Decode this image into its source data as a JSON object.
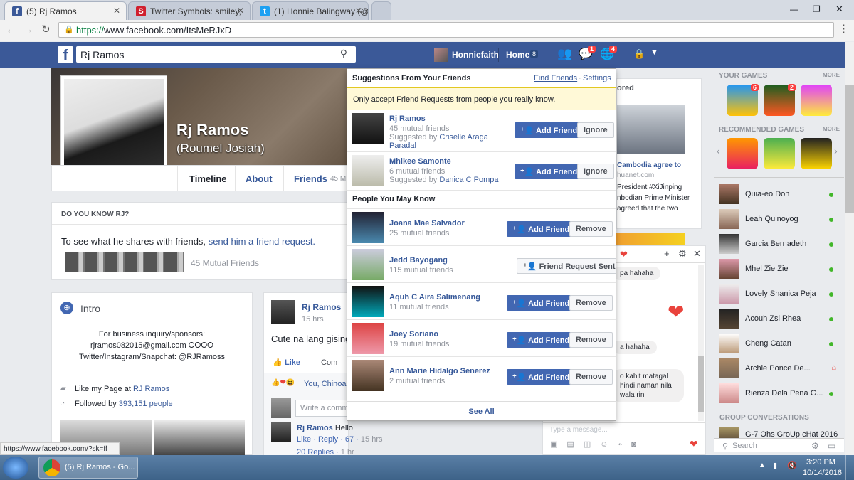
{
  "browser": {
    "tabs": [
      {
        "title": "(5) Rj Ramos",
        "favicon": "f"
      },
      {
        "title": "Twitter Symbols: smiley,",
        "favicon": "S"
      },
      {
        "title": "(1) Honnie Balingway (@",
        "favicon": "t"
      }
    ],
    "url_scheme": "https://",
    "url_rest": "www.facebook.com/ItsMeRJxD",
    "status_url": "https://www.facebook.com/?sk=ff"
  },
  "fb": {
    "search_value": "Rj Ramos",
    "user_name": "Honniefaith",
    "home_label": "Home",
    "home_count": "8",
    "msg_badge": "1",
    "notif_badge": "4"
  },
  "profile": {
    "name": "Rj Ramos",
    "alt_name": "(Roumel Josiah)",
    "tabs": [
      "Timeline",
      "About",
      "Friends",
      "45 M"
    ],
    "know_header": "DO YOU KNOW RJ?",
    "know_text": "To see what he shares with friends,",
    "know_link": "send him a friend request.",
    "mutual": "45 Mutual Friends",
    "intro_title": "Intro",
    "intro_lines": [
      "For business inquiry/sponsors:",
      "rjramos082015@gmail.com ⭘⭘⭘⭘",
      "Twitter/Instagram/Snapchat: @RJRamoss"
    ],
    "likes_page": "Like my Page at",
    "likes_page_link": "RJ Ramos",
    "followed_by": "Followed by",
    "followers": "393,151 people"
  },
  "post": {
    "author": "Rj Ramos",
    "time": "15 hrs",
    "text": "Cute na lang gising",
    "like": "Like",
    "comment": "Com",
    "reactions": "You, Chinoa",
    "comment_placeholder": "Write a comme",
    "reply_author": "Rj Ramos",
    "reply_text": "Hello",
    "reply_like": "Like",
    "reply_reply": "Reply",
    "reply_count": "67",
    "reply_time": "15 hrs",
    "replies": "20 Replies",
    "replies_time": "1 hr"
  },
  "dropdown": {
    "title": "Suggestions From Your Friends",
    "find_friends": "Find Friends",
    "settings": "Settings",
    "notice": "Only accept Friend Requests from people you really know.",
    "suggested": [
      {
        "name": "Rj Ramos",
        "mutual": "45 mutual friends",
        "by_label": "Suggested by",
        "by": "Criselle Araga Paradal",
        "add": "Add Friend",
        "ignore": "Ignore"
      },
      {
        "name": "Mhikee Samonte",
        "mutual": "6 mutual friends",
        "by_label": "Suggested by",
        "by": "Danica C Pompa",
        "add": "Add Friend",
        "ignore": "Ignore"
      }
    ],
    "pymk_title": "People You May Know",
    "people": [
      {
        "name": "Joana Mae Salvador",
        "mutual": "25 mutual friends",
        "action": "Add Friend",
        "remove": "Remove"
      },
      {
        "name": "Jedd Bayogang",
        "mutual": "115 mutual friends",
        "action": "Friend Request Sent",
        "remove": ""
      },
      {
        "name": "Aquh C Aira Salimenang",
        "mutual": "11 mutual friends",
        "action": "Add Friend",
        "remove": "Remove"
      },
      {
        "name": "Joey Soriano",
        "mutual": "19 mutual friends",
        "action": "Add Friend",
        "remove": "Remove"
      },
      {
        "name": "Ann Marie Hidalgo Senerez",
        "mutual": "2 mutual friends",
        "action": "Add Friend",
        "remove": "Remove"
      }
    ],
    "see_all": "See All"
  },
  "sponsored": {
    "label": "ored",
    "headline": "Cambodia agree to",
    "source": "huanet.com",
    "lines": [
      "President #XiJinping",
      "nbodian Prime Minister",
      "agreed that the two"
    ]
  },
  "chat": {
    "msgs": [
      "pa hahaha",
      "a hahaha",
      "o kahit matagal",
      "hindi naman nila",
      "wala rin"
    ],
    "placeholder": "Type a message..."
  },
  "right": {
    "your_games": "YOUR GAMES",
    "more1": "MORE",
    "game_badges": [
      "6",
      "2"
    ],
    "recommended": "RECOMMENDED GAMES",
    "more2": "MORE",
    "contacts": [
      "Quia-eo Don",
      "Leah Quinoyog",
      "Garcia Bernadeth",
      "Mhel Zie Zie",
      "Lovely Shanica Peja",
      "Acouh Zsi Rhea",
      "Cheng Catan",
      "Archie Ponce De...",
      "Rienza Dela Pena G..."
    ],
    "group_title": "GROUP CONVERSATIONS",
    "group_name": "G-7 Ohs GroUp cHat 2016",
    "search": "Search"
  },
  "taskbar": {
    "app": "(5) Rj Ramos - Go...",
    "time": "3:20 PM",
    "date": "10/14/2016"
  },
  "colors": {
    "fb_blue": "#3b5998",
    "button": "#4267b2",
    "online": "#42b72a",
    "badge": "#fa3e3e"
  }
}
